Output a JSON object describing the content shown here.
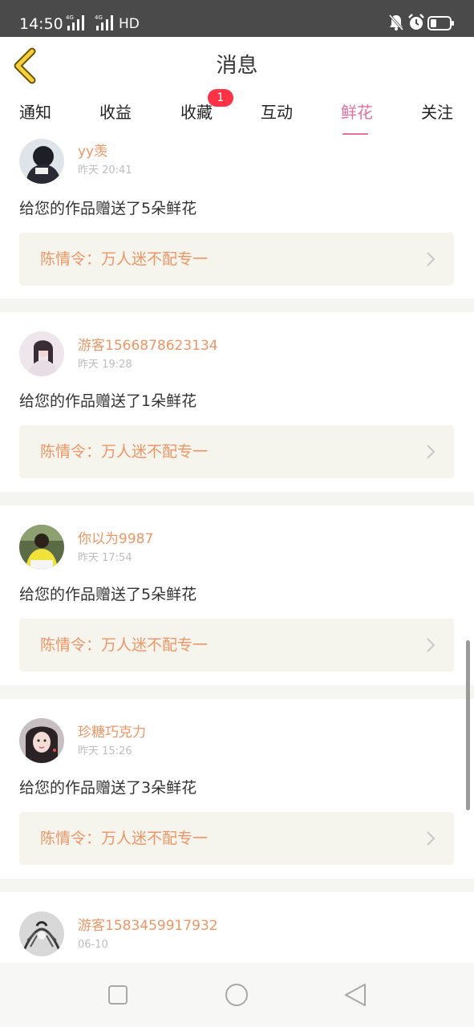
{
  "status_bar": {
    "time": "14:50",
    "network": "HD",
    "icons": [
      "signal-4g-icon",
      "signal-4g-icon",
      "mute-icon",
      "alarm-icon",
      "battery-icon"
    ]
  },
  "header": {
    "title": "消息",
    "back_icon": "chevron-left-icon"
  },
  "tabs": [
    {
      "label": "通知",
      "active": false
    },
    {
      "label": "收益",
      "active": false
    },
    {
      "label": "收藏",
      "active": false,
      "badge": "1"
    },
    {
      "label": "互动",
      "active": false
    },
    {
      "label": "鲜花",
      "active": true
    },
    {
      "label": "关注",
      "active": false
    }
  ],
  "messages": [
    {
      "username": "yy羡",
      "time": "昨天 20:41",
      "text": "给您的作品赠送了5朵鲜花",
      "work_title": "陈情令：万人迷不配专一"
    },
    {
      "username": "游客1566878623134",
      "time": "昨天 19:28",
      "text": "给您的作品赠送了1朵鲜花",
      "work_title": "陈情令：万人迷不配专一"
    },
    {
      "username": "你以为9987",
      "time": "昨天 17:54",
      "text": "给您的作品赠送了5朵鲜花",
      "work_title": "陈情令：万人迷不配专一"
    },
    {
      "username": "珍糖巧克力",
      "time": "昨天 15:26",
      "text": "给您的作品赠送了3朵鲜花",
      "work_title": "陈情令：万人迷不配专一"
    },
    {
      "username": "游客1583459917932",
      "time": "06-10"
    }
  ],
  "navbar": {
    "icons": [
      "recent-apps-icon",
      "home-icon",
      "back-icon"
    ]
  },
  "colors": {
    "accent": "#e46fa0",
    "username": "#ef9565",
    "badge": "#ff3346",
    "card_bg": "#f5f5ee"
  }
}
